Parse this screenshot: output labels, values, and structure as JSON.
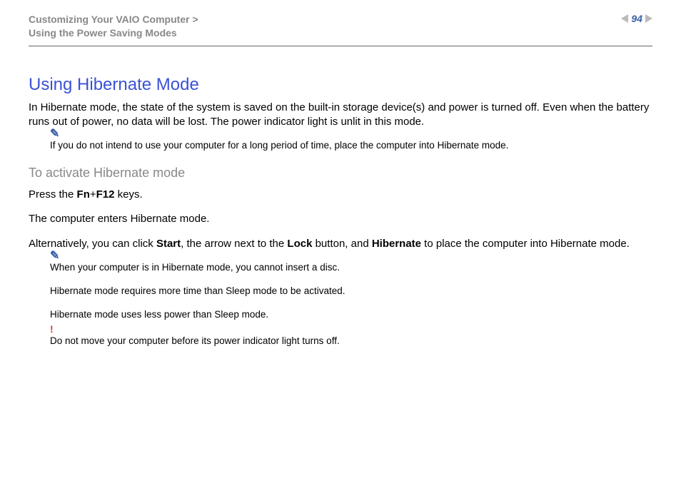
{
  "header": {
    "breadcrumb_line1": "Customizing Your VAIO Computer >",
    "breadcrumb_line2": "Using the Power Saving Modes",
    "page_number": "94"
  },
  "title": "Using Hibernate Mode",
  "intro": "In Hibernate mode, the state of the system is saved on the built-in storage device(s) and power is turned off. Even when the battery runs out of power, no data will be lost. The power indicator light is unlit in this mode.",
  "note1": "If you do not intend to use your computer for a long period of time, place the computer into Hibernate mode.",
  "subhead": "To activate Hibernate mode",
  "press_prefix": "Press the ",
  "press_key1": "Fn",
  "press_plus": "+",
  "press_key2": "F12",
  "press_suffix": " keys.",
  "enters": "The computer enters Hibernate mode.",
  "alt_p1": "Alternatively, you can click ",
  "alt_b1": "Start",
  "alt_p2": ", the arrow next to the ",
  "alt_b2": "Lock",
  "alt_p3": " button, and ",
  "alt_b3": "Hibernate",
  "alt_p4": " to place the computer into Hibernate mode.",
  "note2a": "When your computer is in Hibernate mode, you cannot insert a disc.",
  "note2b": "Hibernate mode requires more time than Sleep mode to be activated.",
  "note2c": "Hibernate mode uses less power than Sleep mode.",
  "warn": "Do not move your computer before its power indicator light turns off.",
  "pencil_glyph": "✎",
  "bang_glyph": "!"
}
